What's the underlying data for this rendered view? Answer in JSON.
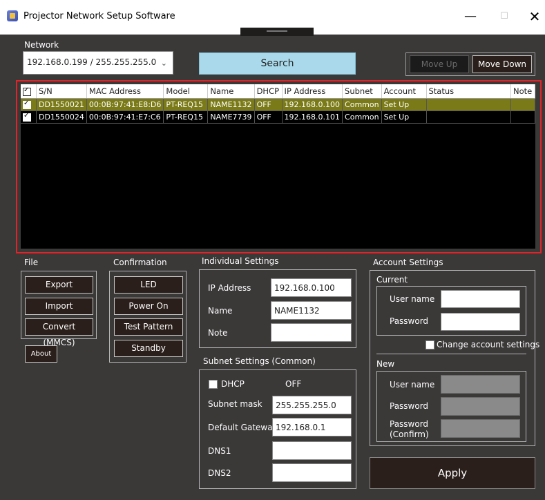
{
  "window": {
    "title": "Projector Network Setup Software",
    "minimize": "—",
    "maximize": "☐",
    "close": "✕"
  },
  "network": {
    "label": "Network",
    "selected": "192.168.0.199 / 255.255.255.0",
    "search_label": "Search",
    "move_up_label": "Move Up",
    "move_down_label": "Move Down"
  },
  "grid": {
    "columns": [
      "S/N",
      "MAC Address",
      "Model",
      "Name",
      "DHCP",
      "IP Address",
      "Subnet",
      "Account",
      "Status",
      "Note"
    ],
    "rows": [
      {
        "checked": true,
        "sn": "DD1550021",
        "mac": "00:0B:97:41:E8:D6",
        "model": "PT-REQ15",
        "name": "NAME1132",
        "dhcp": "OFF",
        "ip": "192.168.0.100",
        "subnet": "Common",
        "account": "Set Up",
        "status": "",
        "note": ""
      },
      {
        "checked": true,
        "sn": "DD1550024",
        "mac": "00:0B:97:41:E7:C6",
        "model": "PT-REQ15",
        "name": "NAME7739",
        "dhcp": "OFF",
        "ip": "192.168.0.101",
        "subnet": "Common",
        "account": "Set Up",
        "status": "",
        "note": ""
      }
    ]
  },
  "file": {
    "label": "File",
    "export": "Export",
    "import": "Import",
    "convert": "Convert (MMCS)",
    "about": "About"
  },
  "confirmation": {
    "label": "Confirmation",
    "led": "LED",
    "power_on": "Power On",
    "test_pattern": "Test Pattern",
    "standby": "Standby"
  },
  "individual": {
    "label": "Individual Settings",
    "ip_label": "IP Address",
    "ip_value": "192.168.0.100",
    "name_label": "Name",
    "name_value": "NAME1132",
    "note_label": "Note",
    "note_value": ""
  },
  "subnet": {
    "label": "Subnet Settings (Common)",
    "dhcp_label": "DHCP",
    "dhcp_state": "OFF",
    "mask_label": "Subnet mask",
    "mask_value": "255.255.255.0",
    "gateway_label": "Default Gateway",
    "gateway_value": "192.168.0.1",
    "dns1_label": "DNS1",
    "dns1_value": "",
    "dns2_label": "DNS2",
    "dns2_value": ""
  },
  "account": {
    "label": "Account Settings",
    "current_label": "Current",
    "username_label": "User name",
    "password_label": "Password",
    "change_label": "Change account settings",
    "new_label": "New",
    "new_username_label": "User name",
    "new_password_label": "Password",
    "confirm_label_1": "Password",
    "confirm_label_2": "(Confirm)"
  },
  "apply_label": "Apply"
}
